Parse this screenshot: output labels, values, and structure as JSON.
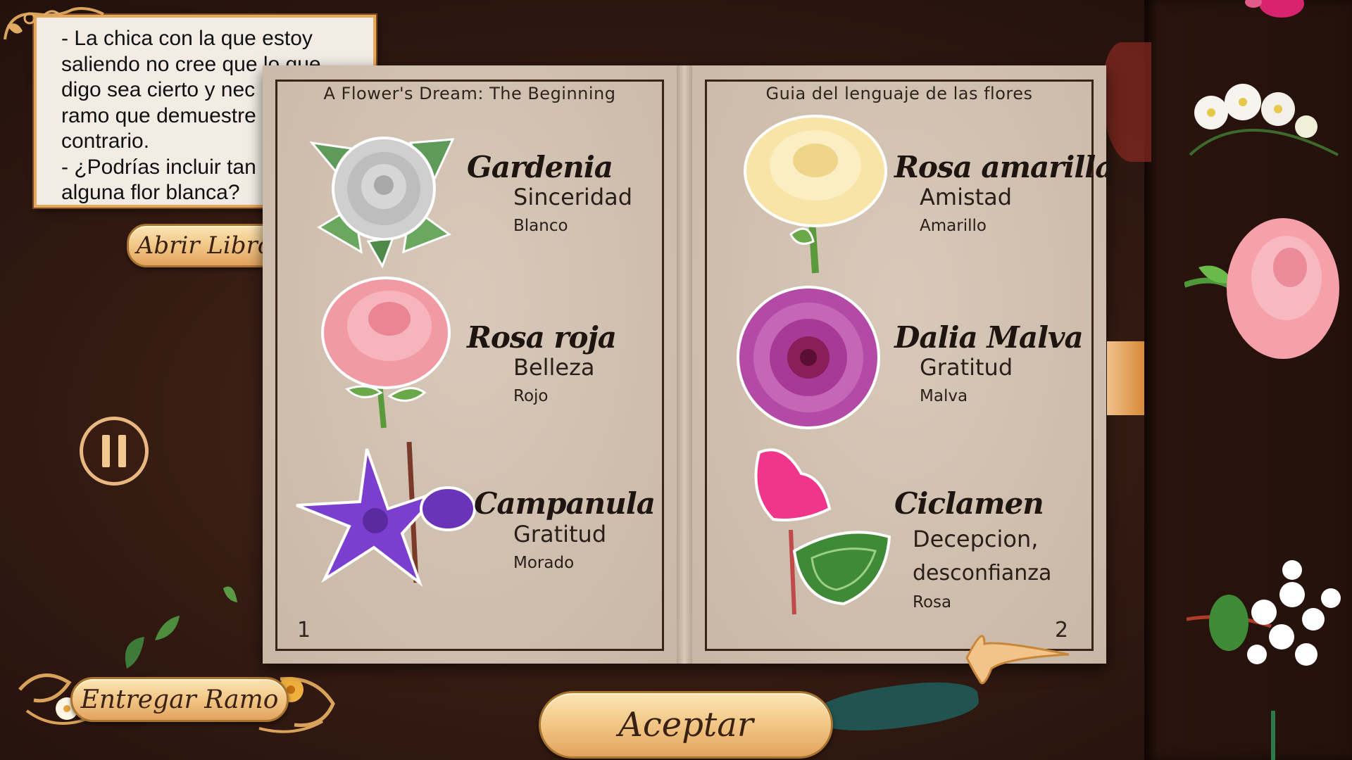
{
  "dialog": {
    "text": "- La chica con la que estoy\nsaliendo no cree que lo que\ndigo sea cierto y nec\nramo que demuestre\ncontrario.\n- ¿Podrías incluir tan\nalguna flor blanca?"
  },
  "buttons": {
    "open_book": "Abrir Libro",
    "deliver_bouquet": "Entregar Ramo",
    "accept": "Aceptar"
  },
  "book": {
    "left_page": {
      "title": "A Flower's Dream: The Beginning",
      "page_number": "1",
      "entries": [
        {
          "name": "Gardenia",
          "meaning": "Sinceridad",
          "color": "Blanco",
          "icon": "gardenia-icon"
        },
        {
          "name": "Rosa roja",
          "meaning": "Belleza",
          "color": "Rojo",
          "icon": "pink-rose-icon"
        },
        {
          "name": "Campanula",
          "meaning": "Gratitud",
          "color": "Morado",
          "icon": "campanula-icon"
        }
      ]
    },
    "right_page": {
      "title": "Guia del lenguaje de las flores",
      "page_number": "2",
      "entries": [
        {
          "name": "Rosa amarilla",
          "meaning": "Amistad",
          "color": "Amarillo",
          "icon": "yellow-rose-icon"
        },
        {
          "name": "Dalia Malva",
          "meaning": "Gratitud",
          "color": "Malva",
          "icon": "dahlia-icon"
        },
        {
          "name": "Ciclamen",
          "meaning": "Decepcion,",
          "meaning2": "desconfianza",
          "color": "Rosa",
          "icon": "cyclamen-icon"
        }
      ]
    }
  },
  "colors": {
    "gold": "#f3c98a",
    "gold_border": "#a8722f",
    "page": "#cdbcac",
    "frame": "#3a2418",
    "background": "#311911"
  }
}
